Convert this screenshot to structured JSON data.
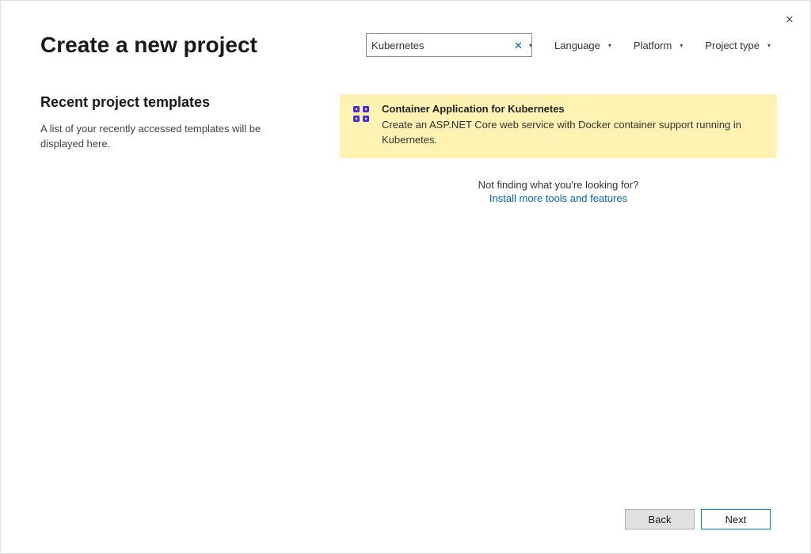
{
  "header": {
    "title": "Create a new project"
  },
  "search": {
    "value": "Kubernetes",
    "clear_symbol": "✕"
  },
  "filters": {
    "language": "Language",
    "platform": "Platform",
    "project_type": "Project type"
  },
  "recent": {
    "title": "Recent project templates",
    "desc": "A list of your recently accessed templates will be displayed here."
  },
  "templates": [
    {
      "title": "Container Application for Kubernetes",
      "desc": "Create an ASP.NET Core web service with Docker container support running in Kubernetes."
    }
  ],
  "notfound": {
    "text": "Not finding what you're looking for?",
    "link": "Install more tools and features"
  },
  "buttons": {
    "back": "Back",
    "next": "Next"
  },
  "colors": {
    "accent": "#0078d4",
    "highlight_bg": "#fff2b3",
    "link": "#0067c0"
  }
}
